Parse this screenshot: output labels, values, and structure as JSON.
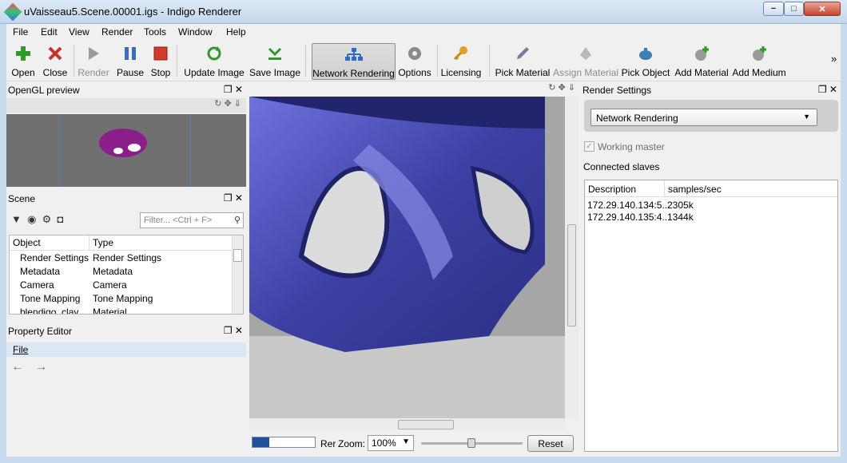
{
  "window": {
    "title": "uVaisseau5.Scene.00001.igs - Indigo Renderer",
    "min": "−",
    "max": "□",
    "close": "✕"
  },
  "menu": [
    "File",
    "Edit",
    "View",
    "Render",
    "Tools",
    "Window",
    "Help"
  ],
  "toolbar": {
    "open": "Open",
    "close": "Close",
    "render": "Render",
    "pause": "Pause",
    "stop": "Stop",
    "update_image": "Update Image",
    "save_image": "Save Image",
    "network_rendering": "Network Rendering",
    "options": "Options",
    "licensing": "Licensing",
    "pick_material": "Pick Material",
    "assign_material": "Assign Material",
    "pick_object": "Pick Object",
    "add_material": "Add Material",
    "add_medium": "Add Medium",
    "more": "»"
  },
  "opengl": {
    "title": "OpenGL preview"
  },
  "scene": {
    "title": "Scene",
    "filter_placeholder": "Filter... <Ctrl + F>",
    "col_object": "Object",
    "col_type": "Type",
    "rows": [
      {
        "object": "Render Settings",
        "type": "Render Settings"
      },
      {
        "object": "Metadata",
        "type": "Metadata"
      },
      {
        "object": "Camera",
        "type": "Camera"
      },
      {
        "object": "Tone Mapping",
        "type": "Tone Mapping"
      },
      {
        "object": "blendigo_clay",
        "type": "Material"
      }
    ]
  },
  "property_editor": {
    "title": "Property Editor",
    "menu_file": "File",
    "back": "←",
    "forward": "→"
  },
  "statusbar": {
    "progress": 0.27,
    "rer": "Rer",
    "zoom_label": "Zoom:",
    "zoom_value": "100%",
    "reset": "Reset"
  },
  "render_settings": {
    "title": "Render Settings",
    "mode": "Network Rendering",
    "working_master": "Working master",
    "working_master_checked": true,
    "connected_slaves": "Connected slaves",
    "col_desc": "Description",
    "col_sps": "samples/sec",
    "slaves": [
      {
        "desc": "172.29.140.134:5...",
        "sps": "2305k"
      },
      {
        "desc": "172.29.140.135:4...",
        "sps": "1344k"
      }
    ]
  },
  "colors": {
    "accent": "#2d4f9f",
    "chrome": "#c9dbef",
    "car": "#4a4fb8"
  }
}
